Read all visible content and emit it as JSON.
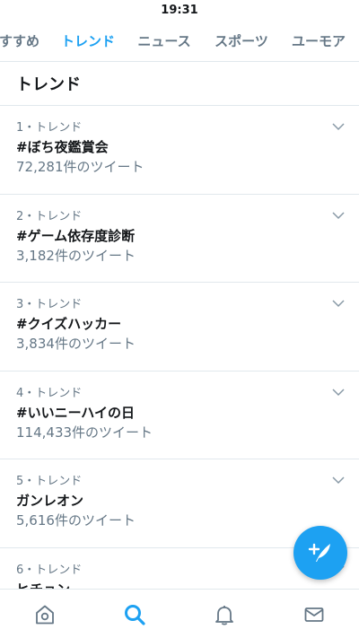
{
  "status_bar": {
    "time": "19:31"
  },
  "tabs": [
    {
      "label": "おすすめ"
    },
    {
      "label": "トレンド",
      "active": true
    },
    {
      "label": "ニュース"
    },
    {
      "label": "スポーツ"
    },
    {
      "label": "ユーモア"
    }
  ],
  "section": {
    "title": "トレンド"
  },
  "trends": [
    {
      "meta": "1・トレンド",
      "name": "#ぼち夜鑑賞会",
      "count": "72,281件のツイート"
    },
    {
      "meta": "2・トレンド",
      "name": "#ゲーム依存度診断",
      "count": "3,182件のツイート"
    },
    {
      "meta": "3・トレンド",
      "name": "#クイズハッカー",
      "count": "3,834件のツイート"
    },
    {
      "meta": "4・トレンド",
      "name": "#いいニーハイの日",
      "count": "114,433件のツイート"
    },
    {
      "meta": "5・トレンド",
      "name": "ガンレオン",
      "count": "5,616件のツイート"
    },
    {
      "meta": "6・トレンド",
      "name": "ヒチョン",
      "count": ""
    }
  ],
  "colors": {
    "accent": "#1da1f2",
    "secondary_text": "#657786",
    "divider": "#e1e8ed"
  },
  "fab": {
    "icon": "compose-tweet-icon"
  },
  "bottom_nav": [
    {
      "icon": "home-icon"
    },
    {
      "icon": "search-icon",
      "active": true
    },
    {
      "icon": "notifications-bell-icon"
    },
    {
      "icon": "messages-envelope-icon"
    }
  ]
}
